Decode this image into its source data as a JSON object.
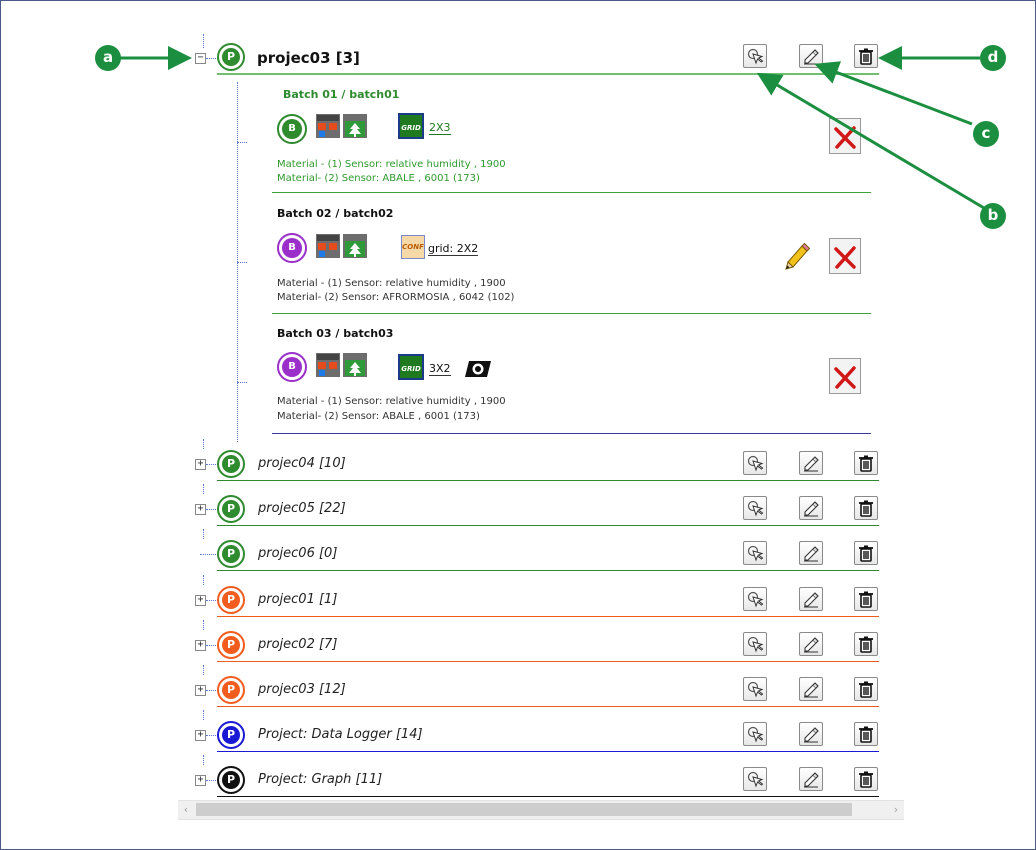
{
  "callouts": {
    "a": "a",
    "b": "b",
    "c": "c",
    "d": "d"
  },
  "expanded_project": {
    "badge": "P",
    "title": "projec03 [3]",
    "expander": "−",
    "color": "#2e8b2e"
  },
  "batches": [
    {
      "title": "Batch 01 / batch01",
      "badge": "B",
      "badge_color": "#2e8b2e",
      "box_label": "GRID",
      "grid_text": "2X3",
      "materials": [
        "Material - (1) Sensor: relative humidity , 1900",
        "Material- (2) Sensor: ABALE , 6001 (173)"
      ],
      "line_color": "#3aa33a"
    },
    {
      "title": "Batch 02 / batch02",
      "badge": "B",
      "badge_color": "#9a2fc9",
      "box_label": "CONF",
      "grid_text": "grid: 2X2",
      "materials": [
        "Material - (1) Sensor: relative humidity , 1900",
        "Material- (2) Sensor: AFRORMOSIA , 6042 (102)"
      ],
      "line_color": "#3aa33a"
    },
    {
      "title": "Batch 03 / batch03",
      "badge": "B",
      "badge_color": "#9a2fc9",
      "box_label": "GRID",
      "grid_text": "3X2",
      "materials": [
        "Material - (1) Sensor: relative humidity , 1900",
        "Material- (2) Sensor: ABALE , 6001 (173)"
      ],
      "line_color": "#3a3aa3"
    }
  ],
  "projects": [
    {
      "badge": "P",
      "title": "projec04 [10]",
      "color": "#2e8b2e",
      "expander": "+"
    },
    {
      "badge": "P",
      "title": "projec05 [22]",
      "color": "#2e8b2e",
      "expander": "+"
    },
    {
      "badge": "P",
      "title": "projec06 [0]",
      "color": "#2e8b2e",
      "expander": ""
    },
    {
      "badge": "P",
      "title": "projec01 [1]",
      "color": "#f25c1e",
      "expander": "+"
    },
    {
      "badge": "P",
      "title": "projec02 [7]",
      "color": "#f25c1e",
      "expander": "+"
    },
    {
      "badge": "P",
      "title": "projec03 [12]",
      "color": "#f25c1e",
      "expander": "+"
    },
    {
      "badge": "P",
      "title": "Project: Data Logger [14]",
      "color": "#1a1ad4",
      "expander": "+"
    },
    {
      "badge": "P",
      "title": "Project: Graph [11]",
      "color": "#111111",
      "expander": "+"
    }
  ],
  "icons": {
    "select": "pointer-click-icon",
    "edit": "eraser-edit-icon",
    "delete": "trash-icon",
    "remove": "red-x-icon",
    "pencil": "pencil-icon",
    "camera": "camera-lens-icon"
  },
  "scroll": {
    "left": "‹",
    "right": "›"
  }
}
